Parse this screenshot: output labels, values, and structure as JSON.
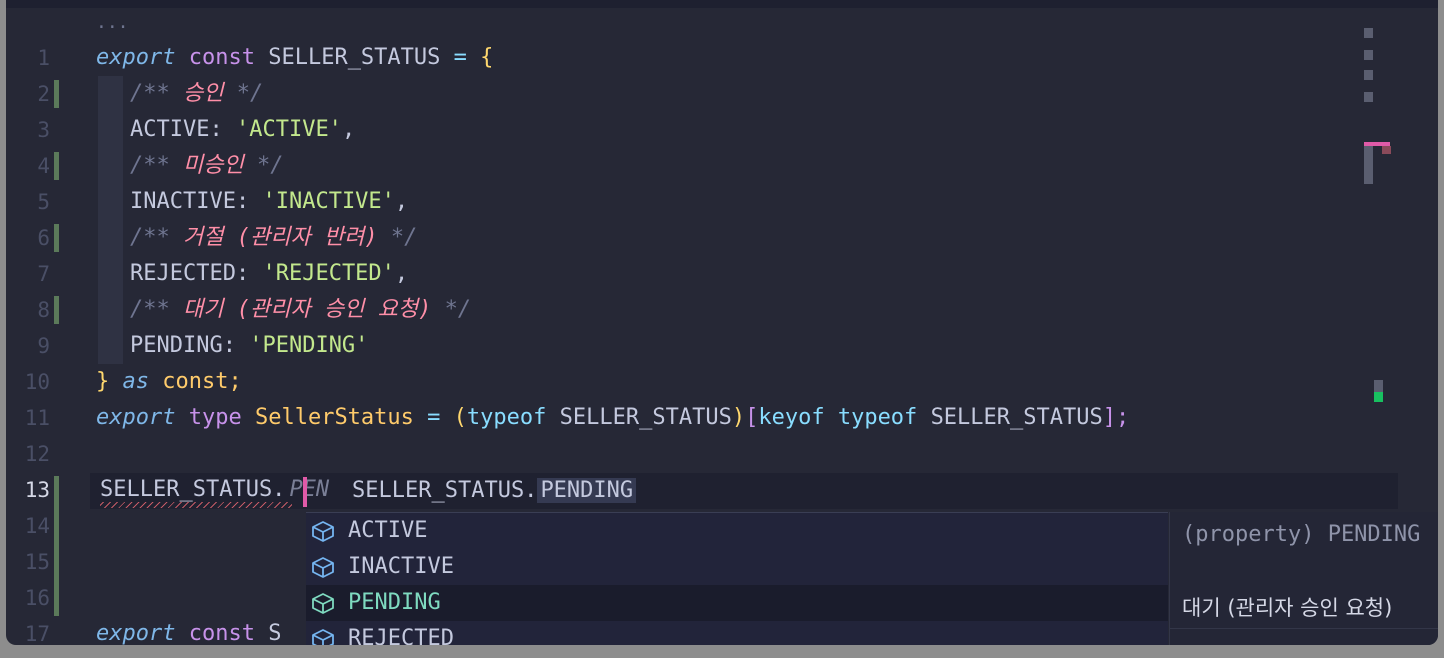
{
  "editor": {
    "folded_indicator": "...",
    "line_numbers": [
      "1",
      "2",
      "3",
      "4",
      "5",
      "6",
      "7",
      "8",
      "9",
      "10",
      "11",
      "12",
      "13",
      "14",
      "15",
      "16",
      "17"
    ],
    "active_line": "13",
    "code": {
      "l1": {
        "k1": "export",
        "k2": "const",
        "id": "SELLER_STATUS",
        "op": "=",
        "brace": "{"
      },
      "l2": {
        "open": "/**",
        "text": "승인",
        "close": "*/"
      },
      "l3": {
        "key": "ACTIVE:",
        "val": "'ACTIVE'",
        "comma": ","
      },
      "l4": {
        "open": "/**",
        "text": "미승인",
        "close": "*/"
      },
      "l5": {
        "key": "INACTIVE:",
        "val": "'INACTIVE'",
        "comma": ","
      },
      "l6": {
        "open": "/**",
        "text": "거절 (관리자 반려)",
        "close": "*/"
      },
      "l7": {
        "key": "REJECTED:",
        "val": "'REJECTED'",
        "comma": ","
      },
      "l8": {
        "open": "/**",
        "text": "대기 (관리자 승인 요청)",
        "close": "*/"
      },
      "l9": {
        "key": "PENDING:",
        "val": "'PENDING'"
      },
      "l10": {
        "brace": "}",
        "as": "as",
        "const": "const;"
      },
      "l11": {
        "k1": "export",
        "k2": "type",
        "tname": "SellerStatus",
        "op": "=",
        "p1": "(",
        "typeof": "typeof",
        "id": "SELLER_STATUS",
        "p2": ")",
        "b1": "[",
        "keyof": "keyof",
        "typeof2": "typeof",
        "id2": "SELLER_STATUS",
        "b2": "];"
      },
      "l13": {
        "typed": "SELLER_STATUS.",
        "ghost": "PEN"
      },
      "l17": {
        "k1": "export",
        "k2": "const",
        "id": "S"
      }
    },
    "inline_preview": {
      "prefix": "SELLER_STATUS.",
      "highlight": "PENDING"
    }
  },
  "suggestions": {
    "items": [
      {
        "label": "ACTIVE",
        "icon": "property-cube-icon"
      },
      {
        "label": "INACTIVE",
        "icon": "property-cube-icon"
      },
      {
        "label": "PENDING",
        "icon": "property-cube-icon",
        "selected": true
      },
      {
        "label": "REJECTED",
        "icon": "property-cube-icon"
      }
    ]
  },
  "details": {
    "signature": "(property) PENDING",
    "doc": "대기 (관리자 승인 요청)"
  },
  "colors": {
    "background": "#262836",
    "keyword": "#c792ea",
    "string": "#c3e88d",
    "type": "#ffcb6b",
    "comment_text": "#ff8fa8",
    "caret": "#e05aa8"
  }
}
